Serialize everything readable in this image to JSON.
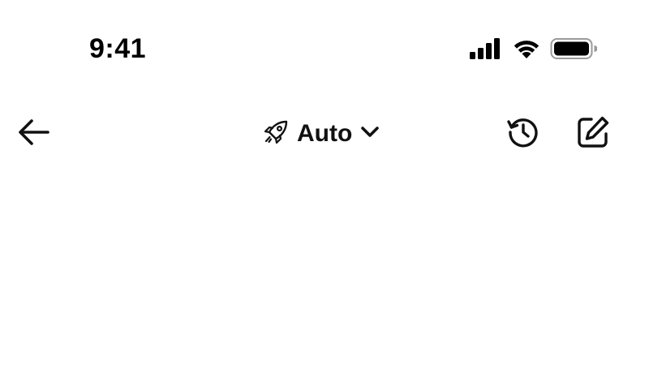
{
  "status_bar": {
    "time": "9:41",
    "icons": [
      "cellular-signal-icon",
      "wifi-icon",
      "battery-icon"
    ],
    "battery_level": 1.0
  },
  "header": {
    "back_icon": "arrow-left-icon",
    "mode": {
      "icon": "rocket-icon",
      "label": "Auto",
      "dropdown_icon": "chevron-down-icon"
    },
    "history_icon": "history-icon",
    "edit_icon": "edit-icon"
  },
  "colors": {
    "background": "#ffffff",
    "foreground": "#111111"
  }
}
